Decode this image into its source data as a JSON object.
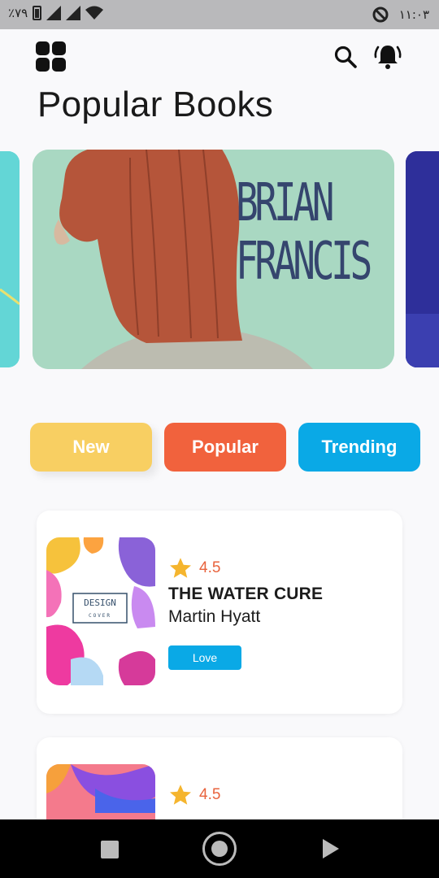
{
  "status_bar": {
    "battery_text": "٪٧٩",
    "time": "١١:٠٣"
  },
  "header": {
    "title": "Popular Books"
  },
  "carousel": {
    "main_cover_text_line1": "BRIAN",
    "main_cover_text_line2": "FRANCIS"
  },
  "tabs": [
    {
      "label": "New",
      "color": "#f8cf62"
    },
    {
      "label": "Popular",
      "color": "#f1623d"
    },
    {
      "label": "Trending",
      "color": "#0aa9e6"
    }
  ],
  "books": [
    {
      "rating": "4.5",
      "title": "THE WATER CURE",
      "author": "Martin Hyatt",
      "button_label": "Love",
      "thumb_text_line1": "DESIGN",
      "thumb_text_line2": "COVER"
    },
    {
      "rating": "4.5"
    }
  ],
  "colors": {
    "accent_orange": "#e8633d",
    "star": "#f5b52e",
    "accent_blue": "#0aa9e6"
  },
  "icons": {
    "menu": "grid-icon",
    "search": "search-icon",
    "notifications": "bell-icon",
    "rating": "star-icon"
  }
}
